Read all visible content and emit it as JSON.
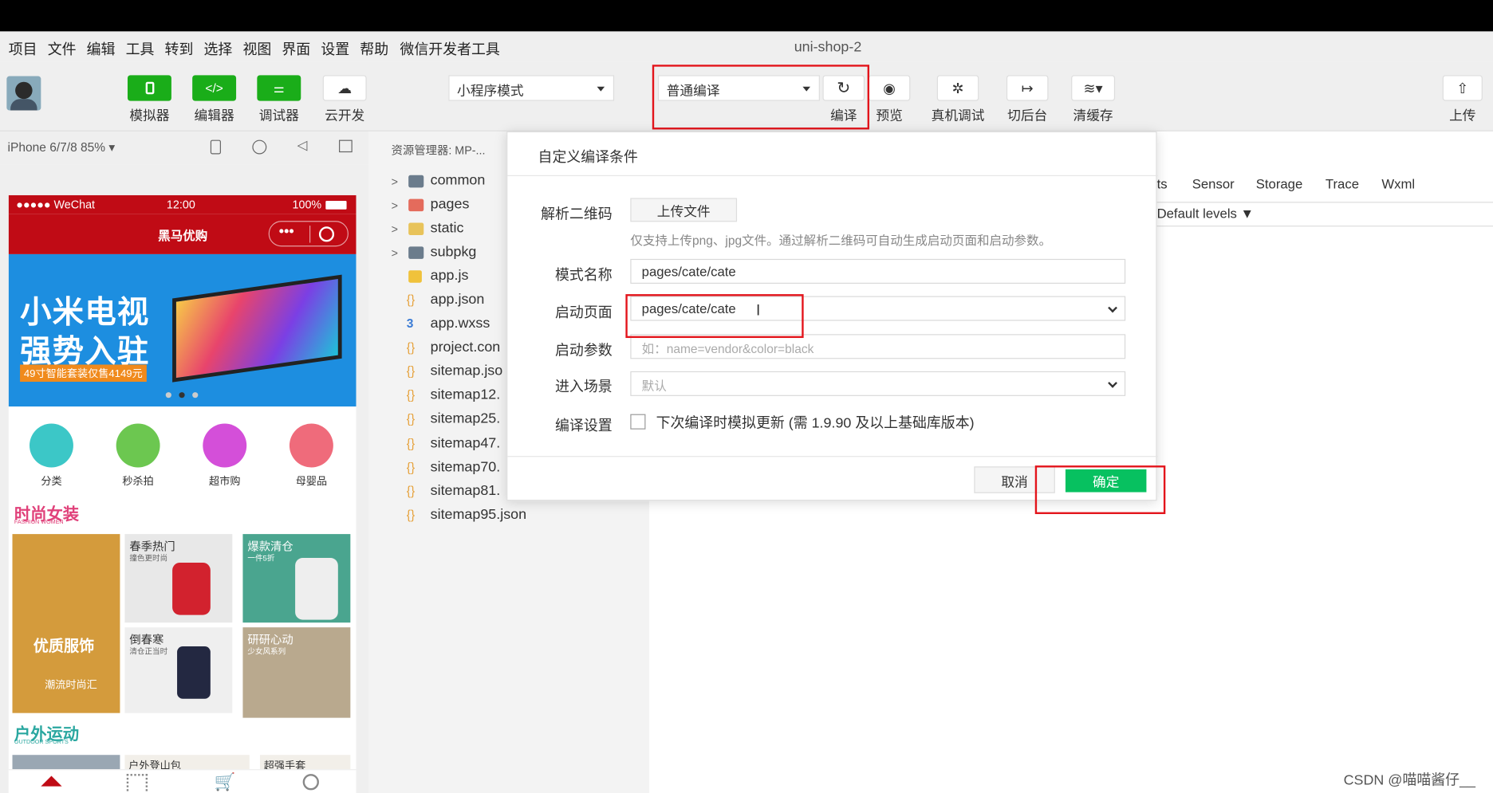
{
  "app_title": "uni-shop-2",
  "menu": [
    "项目",
    "文件",
    "编辑",
    "工具",
    "转到",
    "选择",
    "视图",
    "界面",
    "设置",
    "帮助",
    "微信开发者工具"
  ],
  "toolbar": {
    "simulator": "模拟器",
    "editor": "编辑器",
    "debugger": "调试器",
    "cloud": "云开发",
    "mode": "小程序模式",
    "compile_mode": "普通编译",
    "compile": "编译",
    "preview": "预览",
    "real_debug": "真机调试",
    "background": "切后台",
    "clear_cache": "清缓存",
    "upload": "上传"
  },
  "simulator": {
    "device": "iPhone 6/7/8 85%",
    "status_left": "●●●●● WeChat",
    "status_time": "12:00",
    "status_battery": "100%",
    "nav_title": "黑马优购",
    "banner_text_1": "小米电视",
    "banner_text_2": "强势入驻",
    "banner_sub": "49寸智能套装仅售4149元",
    "categories": [
      "分类",
      "秒杀拍",
      "超市购",
      "母婴品"
    ],
    "floor1_title": "时尚女装",
    "floor1_sub": "FASHION WOMEN",
    "floor1_tiles": [
      "优质服饰",
      "春季热门",
      "爆款清仓",
      "倒春寒",
      "研研心动"
    ],
    "floor1_tile_subs": [
      "潮流时尚汇",
      "撞色更时尚",
      "一件5折",
      "清仓正当时",
      "少女风系列"
    ],
    "floor2_title": "户外运动",
    "floor2_sub": "OUTDOOR SPORTS",
    "floor2_tiles": [
      "户外登山包",
      "超强手套"
    ]
  },
  "explorer": {
    "title": "资源管理器: MP-...",
    "items": [
      "common",
      "pages",
      "static",
      "subpkg",
      "app.js",
      "app.json",
      "app.wxss",
      "project.con",
      "sitemap.jso",
      "sitemap12.",
      "sitemap25.",
      "sitemap47.",
      "sitemap70.",
      "sitemap81.",
      "sitemap95.json"
    ]
  },
  "devtools": {
    "tabs": [
      "ts",
      "Sensor",
      "Storage",
      "Trace",
      "Wxml"
    ],
    "levels": "Default levels ▼"
  },
  "modal": {
    "title": "自定义编译条件",
    "qr_label": "解析二维码",
    "upload_button": "上传文件",
    "hint": "仅支持上传png、jpg文件。通过解析二维码可自动生成启动页面和启动参数。",
    "mode_name_label": "模式名称",
    "mode_name_value": "pages/cate/cate",
    "start_page_label": "启动页面",
    "start_page_value": "pages/cate/cate",
    "params_label": "启动参数",
    "params_placeholder": "如：name=vendor&color=black",
    "scene_label": "进入场景",
    "scene_value": "默认",
    "compile_settings_label": "编译设置",
    "checkbox_label": "下次编译时模拟更新 (需 1.9.90 及以上基础库版本)",
    "cancel": "取消",
    "ok": "确定"
  },
  "watermark": "CSDN @喵喵酱仔__",
  "colors": {
    "green": "#1aad19",
    "ok_green": "#07c160",
    "red_highlight": "#e3141b",
    "wechat_red": "#c00b15"
  }
}
